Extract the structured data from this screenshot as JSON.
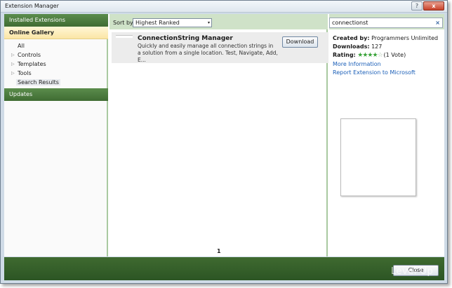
{
  "window": {
    "title": "Extension Manager",
    "help_glyph": "?",
    "close_glyph": "x"
  },
  "nav": {
    "installed": "Installed Extensions",
    "online": "Online Gallery",
    "items": [
      {
        "label": "All",
        "has_arrow": false,
        "arrow": ""
      },
      {
        "label": "Controls",
        "has_arrow": true,
        "arrow": "▷"
      },
      {
        "label": "Templates",
        "has_arrow": true,
        "arrow": "▷"
      },
      {
        "label": "Tools",
        "has_arrow": true,
        "arrow": "▷"
      },
      {
        "label": "Search Results",
        "has_arrow": false,
        "arrow": ""
      }
    ],
    "updates": "Updates"
  },
  "sort": {
    "label": "Sort by:",
    "value": "Highest Ranked",
    "chevron": "▾"
  },
  "result": {
    "name": "ConnectionString Manager",
    "description": "Quickly and easily manage all connection strings in a solution from a single location. Test, Navigate, Add, E...",
    "download_label": "Download"
  },
  "pager": {
    "page": "1"
  },
  "search": {
    "value": "connectionst",
    "clear_glyph": "×"
  },
  "details": {
    "created_by_label": "Created by:",
    "created_by": "Programmers Unlimited",
    "downloads_label": "Downloads:",
    "downloads": "127",
    "rating_label": "Rating:",
    "rating_stars_filled": "★★★★",
    "rating_stars_empty": "☆",
    "rating_votes": "(1 Vote)",
    "rating_value": 4,
    "more_info": "More Information",
    "report": "Report Extension to Microsoft"
  },
  "footer": {
    "close_label": "Close"
  },
  "watermark": "Level Up",
  "colors": {
    "nav_green": "#3f6c33",
    "accent_green": "#cfe2c8",
    "link": "#1b5fb8",
    "selection": "#fbe6a6"
  }
}
